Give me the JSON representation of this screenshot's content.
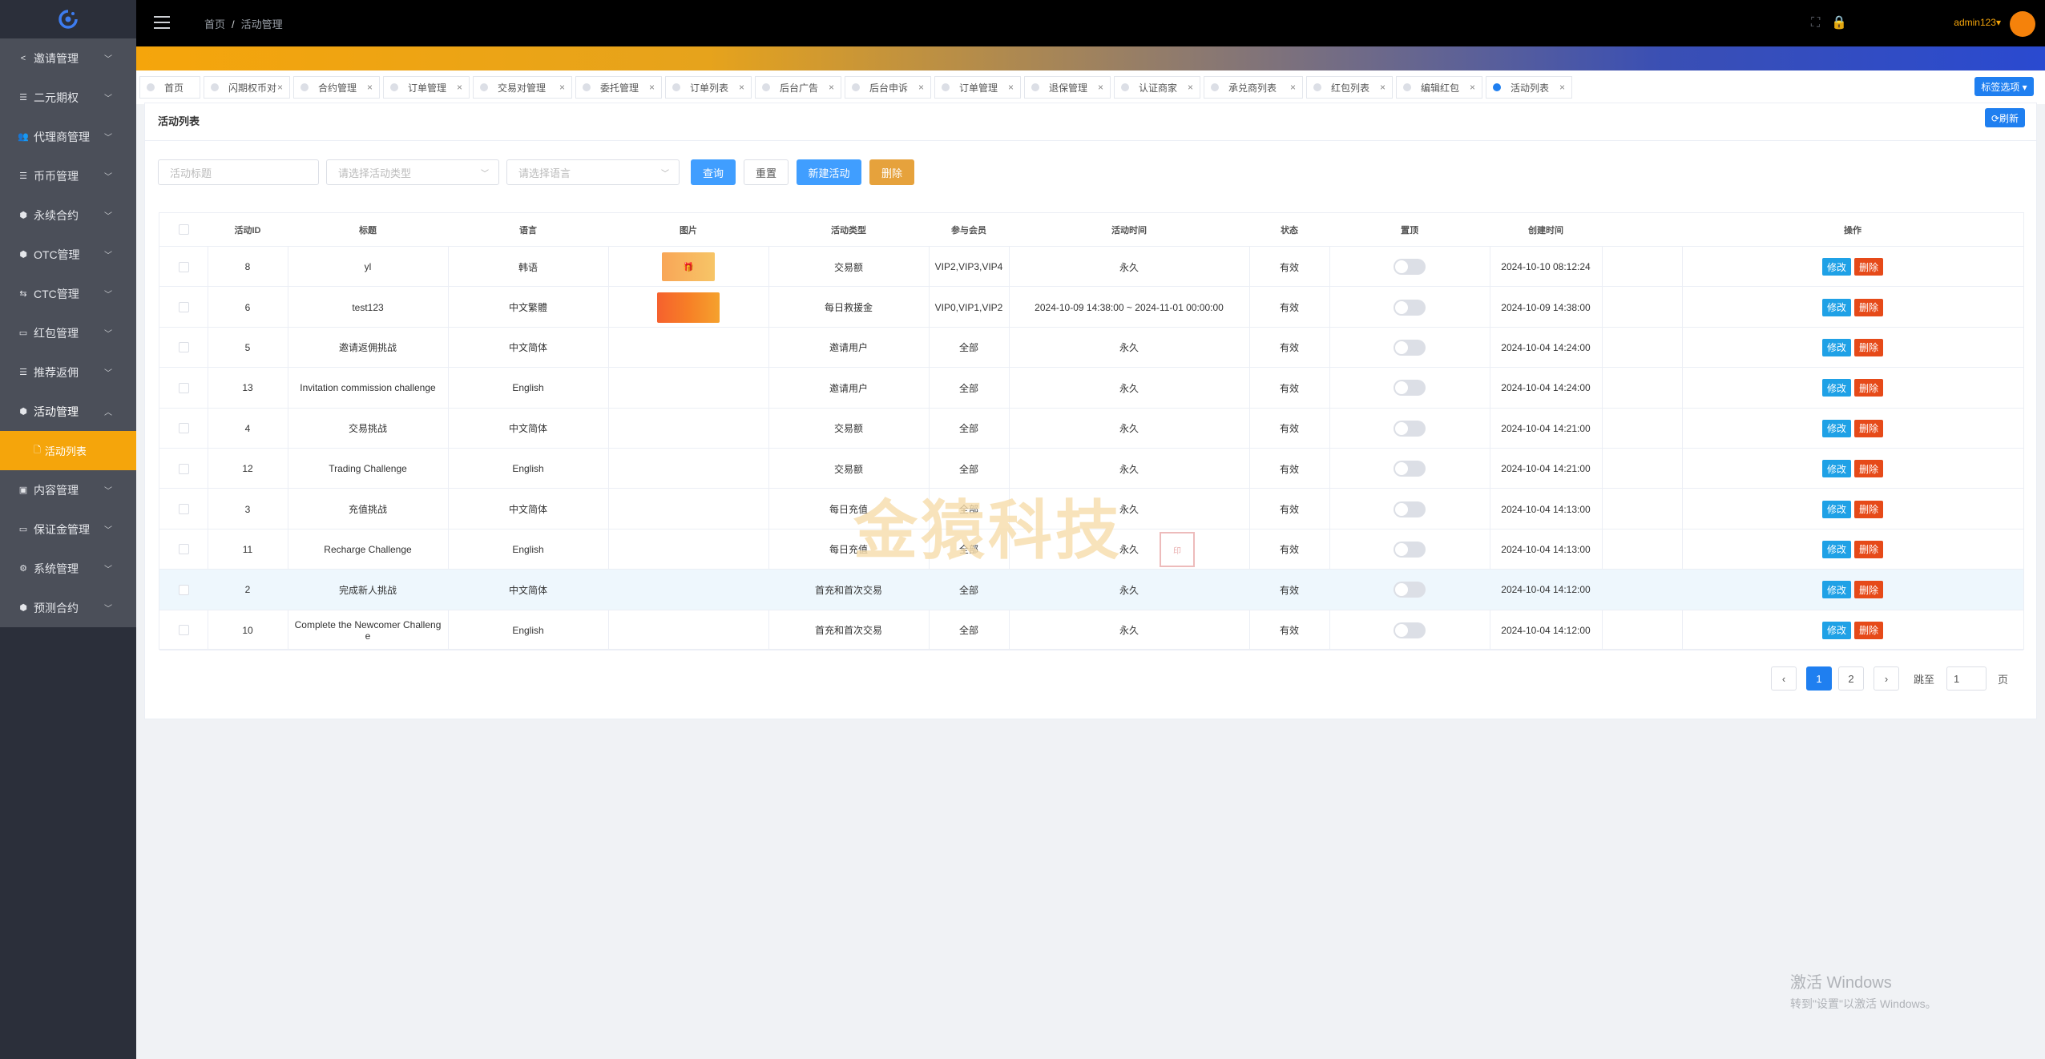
{
  "header": {
    "breadcrumb_home": "首页",
    "breadcrumb_sep": "/",
    "breadcrumb_current": "活动管理",
    "username": "admin123▾"
  },
  "sidebar": {
    "items": [
      {
        "label": "邀请管理",
        "icon": "share-icon"
      },
      {
        "label": "二元期权",
        "icon": "sliders-icon"
      },
      {
        "label": "代理商管理",
        "icon": "users-icon"
      },
      {
        "label": "币币管理",
        "icon": "sliders-icon"
      },
      {
        "label": "永续合约",
        "icon": "cube-icon"
      },
      {
        "label": "OTC管理",
        "icon": "cube-icon"
      },
      {
        "label": "CTC管理",
        "icon": "swap-icon"
      },
      {
        "label": "红包管理",
        "icon": "card-icon"
      },
      {
        "label": "推荐返佣",
        "icon": "sliders-icon"
      },
      {
        "label": "活动管理",
        "icon": "cube-icon"
      },
      {
        "label": "内容管理",
        "icon": "image-icon"
      },
      {
        "label": "保证金管理",
        "icon": "card-icon"
      },
      {
        "label": "系统管理",
        "icon": "gear-icon"
      },
      {
        "label": "预测合约",
        "icon": "cube-icon"
      }
    ],
    "sub_item": "活动列表"
  },
  "tags": [
    {
      "label": "首页"
    },
    {
      "label": "闪期权币对"
    },
    {
      "label": "合约管理"
    },
    {
      "label": "订单管理"
    },
    {
      "label": "交易对管理"
    },
    {
      "label": "委托管理"
    },
    {
      "label": "订单列表"
    },
    {
      "label": "后台广告"
    },
    {
      "label": "后台申诉"
    },
    {
      "label": "订单管理"
    },
    {
      "label": "退保管理"
    },
    {
      "label": "认证商家"
    },
    {
      "label": "承兑商列表"
    },
    {
      "label": "红包列表"
    },
    {
      "label": "编辑红包"
    },
    {
      "label": "活动列表"
    }
  ],
  "tag_close": "×",
  "tag_options": "标签选项 ▾",
  "panel": {
    "title": "活动列表",
    "refresh": "⟳刷新"
  },
  "filters": {
    "title_placeholder": "活动标题",
    "type_placeholder": "请选择活动类型",
    "lang_placeholder": "请选择语言",
    "query": "查询",
    "reset": "重置",
    "create": "新建活动",
    "delete": "删除"
  },
  "table": {
    "headers": [
      "活动ID",
      "标题",
      "语言",
      "图片",
      "活动类型",
      "参与会员",
      "活动时间",
      "状态",
      "置顶",
      "创建时间",
      "操作"
    ],
    "rows": [
      {
        "id": "8",
        "title": "yl",
        "lang": "韩语",
        "img": "thumb1",
        "type": "交易额",
        "members": "VIP2,VIP3,VIP4",
        "time": "永久",
        "status": "有效",
        "created": "2024-10-10 08:12:24"
      },
      {
        "id": "6",
        "title": "test123",
        "lang": "中文繁體",
        "img": "thumb2",
        "type": "每日救援金",
        "members": "VIP0,VIP1,VIP2",
        "time": "2024-10-09 14:38:00 ~ 2024-11-01 00:00:00",
        "status": "有效",
        "created": "2024-10-09 14:38:00"
      },
      {
        "id": "5",
        "title": "邀请返佣挑战",
        "lang": "中文简体",
        "img": "",
        "type": "邀请用户",
        "members": "全部",
        "time": "永久",
        "status": "有效",
        "created": "2024-10-04 14:24:00"
      },
      {
        "id": "13",
        "title": "Invitation commission challenge",
        "lang": "English",
        "img": "",
        "type": "邀请用户",
        "members": "全部",
        "time": "永久",
        "status": "有效",
        "created": "2024-10-04 14:24:00"
      },
      {
        "id": "4",
        "title": "交易挑战",
        "lang": "中文简体",
        "img": "",
        "type": "交易额",
        "members": "全部",
        "time": "永久",
        "status": "有效",
        "created": "2024-10-04 14:21:00"
      },
      {
        "id": "12",
        "title": "Trading Challenge",
        "lang": "English",
        "img": "",
        "type": "交易额",
        "members": "全部",
        "time": "永久",
        "status": "有效",
        "created": "2024-10-04 14:21:00"
      },
      {
        "id": "3",
        "title": "充值挑战",
        "lang": "中文简体",
        "img": "",
        "type": "每日充值",
        "members": "全部",
        "time": "永久",
        "status": "有效",
        "created": "2024-10-04 14:13:00"
      },
      {
        "id": "11",
        "title": "Recharge Challenge",
        "lang": "English",
        "img": "",
        "type": "每日充值",
        "members": "全部",
        "time": "永久",
        "status": "有效",
        "created": "2024-10-04 14:13:00"
      },
      {
        "id": "2",
        "title": "完成新人挑战",
        "lang": "中文简体",
        "img": "",
        "type": "首充和首次交易",
        "members": "全部",
        "time": "永久",
        "status": "有效",
        "created": "2024-10-04 14:12:00"
      },
      {
        "id": "10",
        "title": "Complete the Newcomer Challenge",
        "lang": "English",
        "img": "",
        "type": "首充和首次交易",
        "members": "全部",
        "time": "永久",
        "status": "有效",
        "created": "2024-10-04 14:12:00"
      }
    ],
    "edit": "修改",
    "del": "删除"
  },
  "pagination": {
    "prev": "‹",
    "page1": "1",
    "page2": "2",
    "next": "›",
    "goto": "跳至",
    "goto_value": "1",
    "page_suffix": "页"
  },
  "watermark": "金猿科技",
  "windows": {
    "line1": "激活 Windows",
    "line2": "转到\"设置\"以激活 Windows。"
  }
}
